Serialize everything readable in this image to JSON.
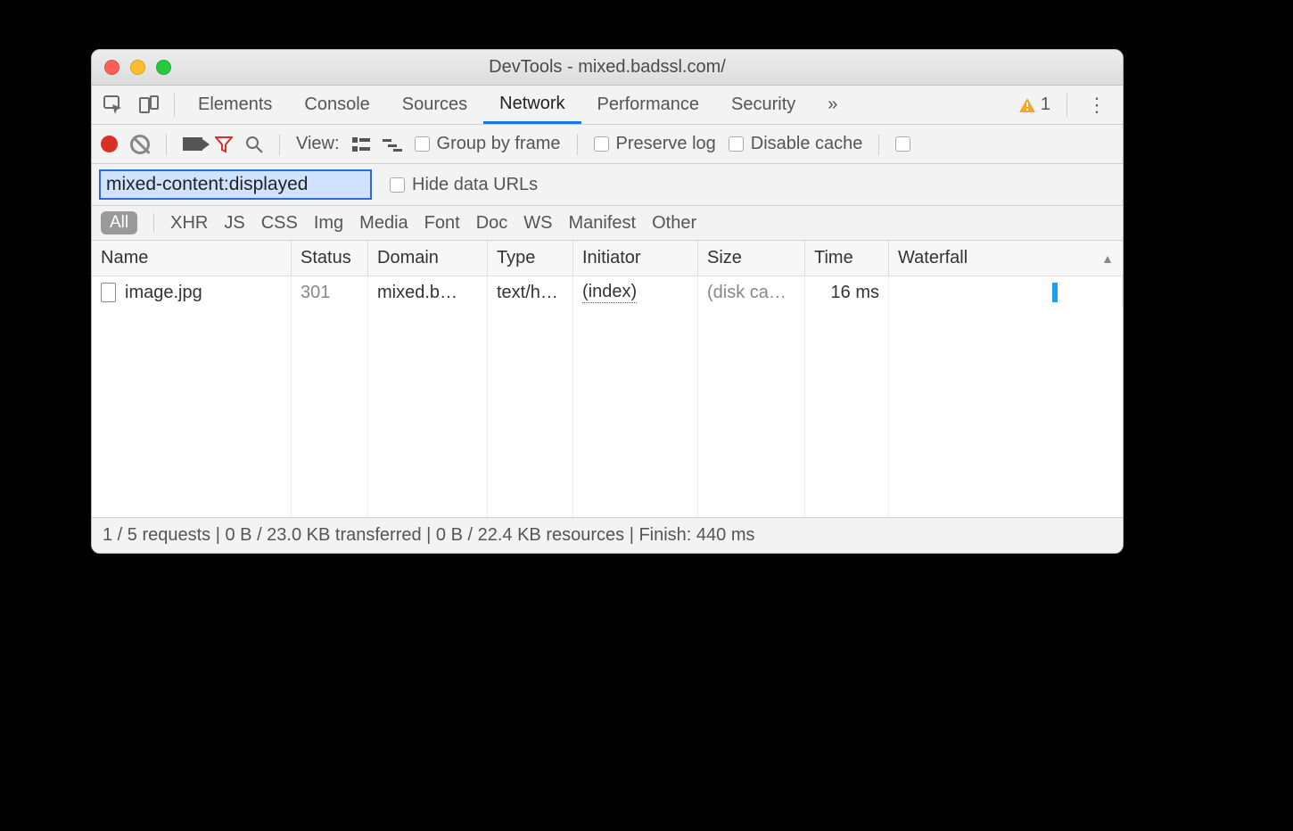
{
  "window": {
    "title": "DevTools - mixed.badssl.com/"
  },
  "tabs": {
    "items": [
      "Elements",
      "Console",
      "Sources",
      "Network",
      "Performance",
      "Security"
    ],
    "active": "Network",
    "more_icon": "»",
    "warning_count": "1"
  },
  "toolbar": {
    "view_label": "View:",
    "group_by_frame": "Group by frame",
    "preserve_log": "Preserve log",
    "disable_cache": "Disable cache"
  },
  "filter": {
    "value": "mixed-content:displayed",
    "hide_data_urls": "Hide data URLs"
  },
  "types": {
    "all": "All",
    "items": [
      "XHR",
      "JS",
      "CSS",
      "Img",
      "Media",
      "Font",
      "Doc",
      "WS",
      "Manifest",
      "Other"
    ]
  },
  "table": {
    "headers": {
      "name": "Name",
      "status": "Status",
      "domain": "Domain",
      "type": "Type",
      "initiator": "Initiator",
      "size": "Size",
      "time": "Time",
      "waterfall": "Waterfall"
    },
    "sort_indicator": "▲",
    "rows": [
      {
        "name": "image.jpg",
        "status": "301",
        "domain": "mixed.b…",
        "type": "text/h…",
        "initiator": "(index)",
        "size": "(disk ca…",
        "time": "16 ms"
      }
    ]
  },
  "status": {
    "text": "1 / 5 requests | 0 B / 23.0 KB transferred | 0 B / 22.4 KB resources | Finish: 440 ms"
  }
}
